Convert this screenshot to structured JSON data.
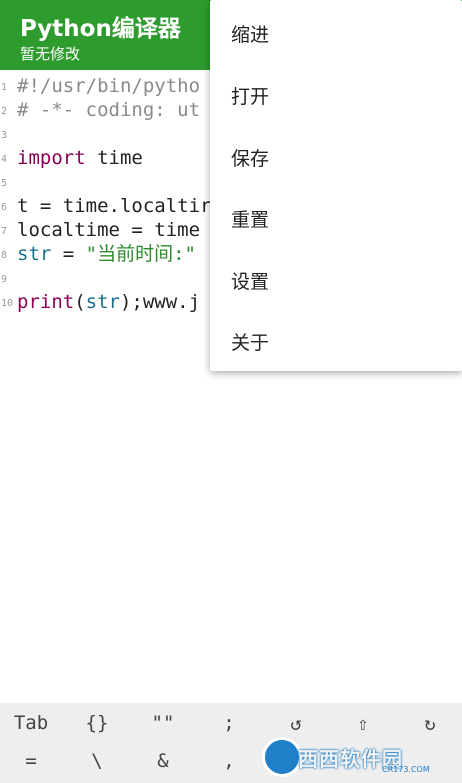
{
  "app": {
    "title": "Python编译器",
    "subtitle": "暂无修改",
    "accent_color": "#2e9b2e"
  },
  "editor": {
    "line_numbers": [
      "1",
      "2",
      "3",
      "4",
      "5",
      "6",
      "7",
      "8",
      "9",
      "10"
    ],
    "lines": [
      {
        "segments": [
          {
            "text": "#!/usr/bin/pytho",
            "kind": "comment"
          }
        ]
      },
      {
        "segments": [
          {
            "text": "# -*- coding: ut",
            "kind": "comment"
          }
        ]
      },
      {
        "segments": []
      },
      {
        "segments": [
          {
            "text": "import",
            "kind": "keyword"
          },
          {
            "text": " time",
            "kind": "plain"
          }
        ]
      },
      {
        "segments": []
      },
      {
        "segments": [
          {
            "text": "t = time.localtir",
            "kind": "plain"
          }
        ]
      },
      {
        "segments": [
          {
            "text": "localtime = time",
            "kind": "plain"
          }
        ]
      },
      {
        "segments": [
          {
            "text": "str",
            "kind": "builtin"
          },
          {
            "text": " = ",
            "kind": "plain"
          },
          {
            "text": "\"当前时间:\"",
            "kind": "string"
          }
        ]
      },
      {
        "segments": []
      },
      {
        "segments": [
          {
            "text": "print",
            "kind": "keyword"
          },
          {
            "text": "(",
            "kind": "plain"
          },
          {
            "text": "str",
            "kind": "builtin"
          },
          {
            "text": ");www.j",
            "kind": "plain"
          }
        ]
      }
    ]
  },
  "menu": {
    "items": [
      {
        "label": "缩进"
      },
      {
        "label": "打开"
      },
      {
        "label": "保存"
      },
      {
        "label": "重置"
      },
      {
        "label": "设置"
      },
      {
        "label": "关于"
      }
    ]
  },
  "symbar": {
    "row1": [
      "Tab",
      "{}",
      "\"\"",
      ";",
      "↺",
      "⇧",
      "↻"
    ],
    "row2": [
      "=",
      "\\",
      "&",
      ","
    ]
  },
  "watermark": {
    "text": "西西软件园",
    "sub": "CR173.COM",
    "icon": "cr173-logo-icon"
  }
}
